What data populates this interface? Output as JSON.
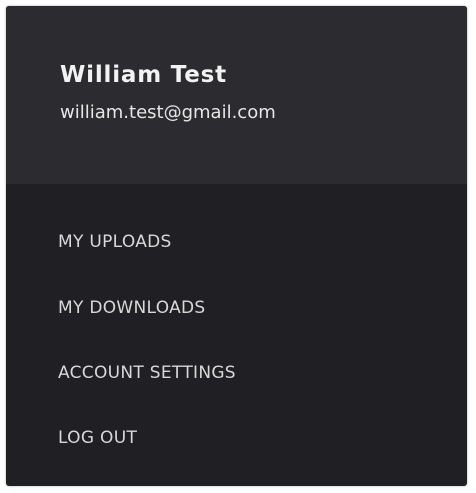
{
  "user": {
    "name": "William Test",
    "email": "william.test@gmail.com"
  },
  "menu": {
    "items": [
      {
        "label": "MY UPLOADS"
      },
      {
        "label": "MY DOWNLOADS"
      },
      {
        "label": "ACCOUNT SETTINGS"
      },
      {
        "label": "LOG OUT"
      }
    ]
  },
  "colors": {
    "header_background": "#2c2c30",
    "menu_background": "#202024",
    "text": "#e6e6e6"
  }
}
